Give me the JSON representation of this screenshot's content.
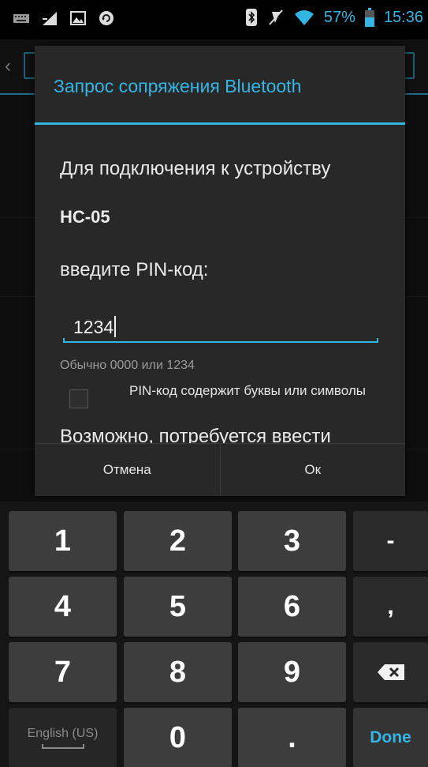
{
  "status_bar": {
    "battery_percent": "57%",
    "time": "15:36",
    "left_icons": [
      "keyboard-icon",
      "signal-icon",
      "image-icon",
      "sync-icon"
    ],
    "right_icons": [
      "bluetooth-icon",
      "mute-icon",
      "wifi-icon",
      "battery-icon"
    ]
  },
  "dialog": {
    "title": "Запрос сопряжения Bluetooth",
    "message_line1": "Для подключения к устройству",
    "device_name": "HC-05",
    "message_line2": "введите PIN-код:",
    "pin_value": "1234",
    "hint": "Обычно 0000 или 1234",
    "checkbox_label": "PIN-код содержит буквы или символы",
    "checkbox_checked": false,
    "message_more": "Возможно, потребуется ввести",
    "cancel_label": "Отмена",
    "ok_label": "Ок"
  },
  "keyboard": {
    "rows": [
      [
        "1",
        "2",
        "3",
        "-"
      ],
      [
        "4",
        "5",
        "6",
        ","
      ],
      [
        "7",
        "8",
        "9",
        "backspace"
      ],
      [
        "English (US)",
        "0",
        ".",
        "Done"
      ]
    ],
    "key_1": "1",
    "key_2": "2",
    "key_3": "3",
    "key_dash": "-",
    "key_4": "4",
    "key_5": "5",
    "key_6": "6",
    "key_comma": ",",
    "key_7": "7",
    "key_8": "8",
    "key_9": "9",
    "key_lang": "English (US)",
    "key_0": "0",
    "key_dot": ".",
    "key_done": "Done"
  },
  "colors": {
    "accent": "#33b5e5",
    "dialog_bg": "#282828",
    "key_bg": "#3d3d3d"
  }
}
